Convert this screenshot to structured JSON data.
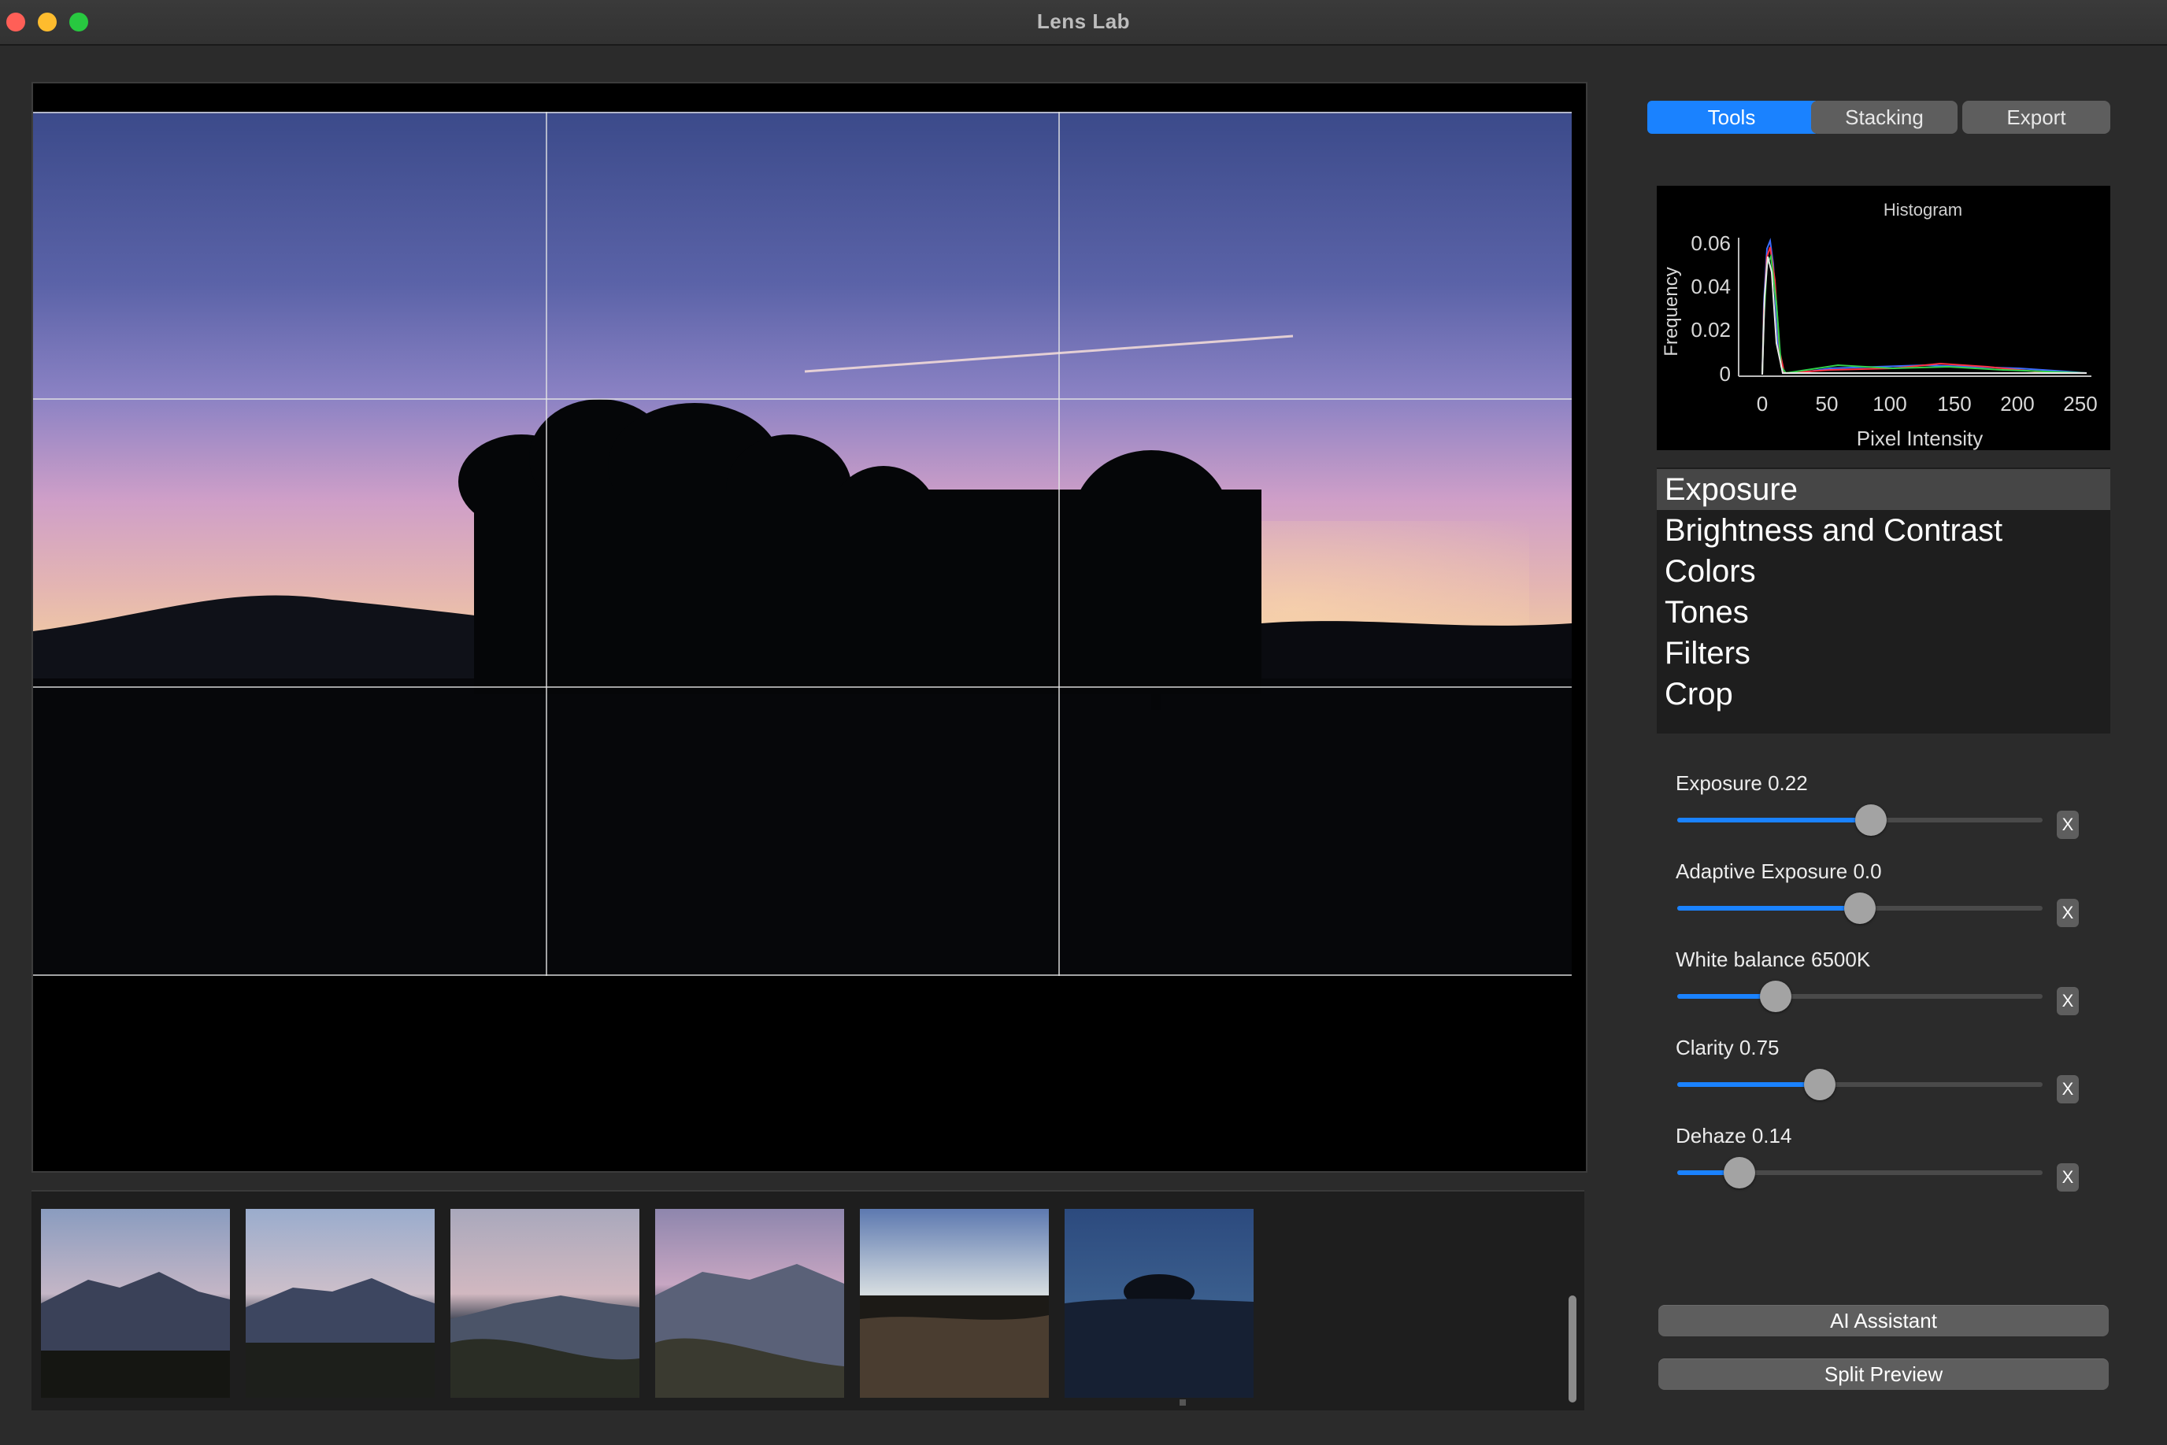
{
  "window": {
    "title": "Lens Lab"
  },
  "tabs": [
    {
      "label": "Tools",
      "active": true
    },
    {
      "label": "Stacking",
      "active": false
    },
    {
      "label": "Export",
      "active": false
    }
  ],
  "histogram": {
    "title": "Histogram",
    "xlabel": "Pixel Intensity",
    "ylabel": "Frequency",
    "x_ticks": [
      "0",
      "50",
      "100",
      "150",
      "200",
      "250"
    ],
    "y_ticks": [
      "0",
      "0.02",
      "0.04",
      "0.06"
    ]
  },
  "tools": [
    {
      "label": "Exposure",
      "selected": true
    },
    {
      "label": "Brightness and Contrast",
      "selected": false
    },
    {
      "label": "Colors",
      "selected": false
    },
    {
      "label": "Tones",
      "selected": false
    },
    {
      "label": "Filters",
      "selected": false
    },
    {
      "label": "Crop",
      "selected": false
    }
  ],
  "sliders": [
    {
      "label": "Exposure 0.22",
      "fraction": 0.53,
      "reset": "X"
    },
    {
      "label": "Adaptive Exposure 0.0",
      "fraction": 0.5,
      "reset": "X"
    },
    {
      "label": "White balance 6500K",
      "fraction": 0.27,
      "reset": "X"
    },
    {
      "label": "Clarity 0.75",
      "fraction": 0.39,
      "reset": "X"
    },
    {
      "label": "Dehaze 0.14",
      "fraction": 0.17,
      "reset": "X"
    }
  ],
  "buttons": {
    "ai_assistant": "AI Assistant",
    "split_preview": "Split Preview"
  },
  "colors": {
    "accent": "#1a82ff",
    "panel": "#2b2b2b"
  }
}
